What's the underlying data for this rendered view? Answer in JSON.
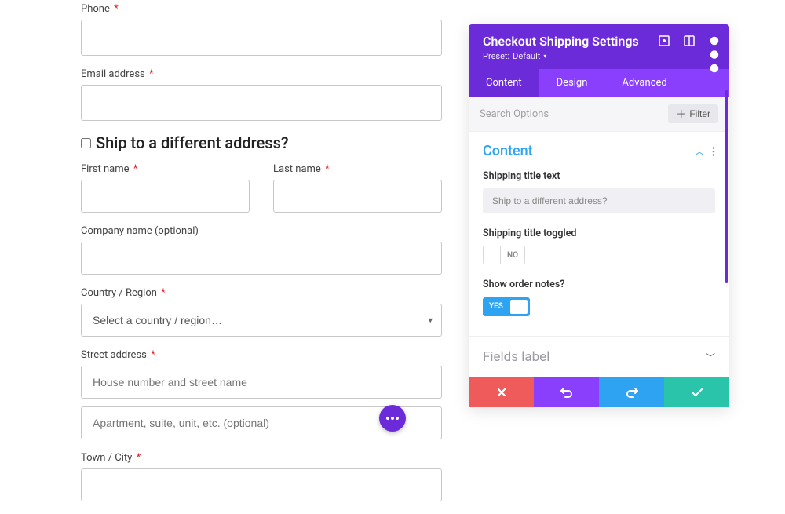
{
  "form": {
    "phone_label": "Phone",
    "email_label": "Email address",
    "ship_diff_label": "Ship to a different address?",
    "first_name_label": "First name",
    "last_name_label": "Last name",
    "company_label": "Company name (optional)",
    "country_label": "Country / Region",
    "country_placeholder": "Select a country / region…",
    "street_label": "Street address",
    "street1_placeholder": "House number and street name",
    "street2_placeholder": "Apartment, suite, unit, etc. (optional)",
    "town_label": "Town / City",
    "required_mark": "*"
  },
  "panel": {
    "title": "Checkout Shipping Settings",
    "preset_label": "Preset:",
    "preset_value": "Default",
    "tabs": {
      "content": "Content",
      "design": "Design",
      "advanced": "Advanced"
    },
    "search_placeholder": "Search Options",
    "filter_label": "Filter",
    "section_title": "Content",
    "fields": {
      "shipping_title_label": "Shipping title text",
      "shipping_title_value": "Ship to a different address?",
      "shipping_toggled_label": "Shipping title toggled",
      "shipping_toggled_value": "NO",
      "order_notes_label": "Show order notes?",
      "order_notes_value": "YES"
    },
    "fields_label_section": "Fields label"
  }
}
